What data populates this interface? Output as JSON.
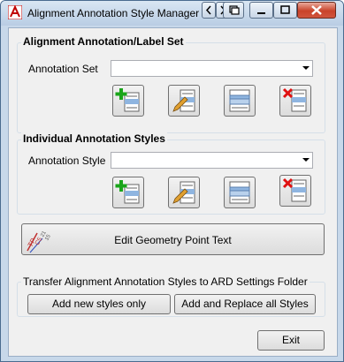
{
  "window": {
    "title": "Alignment Annotation Style Manager"
  },
  "alignment_set": {
    "heading": "Alignment Annotation/Label Set",
    "label": "Annotation Set",
    "value": ""
  },
  "individual_styles": {
    "heading": "Individual Annotation Styles",
    "label": "Annotation Style",
    "value": ""
  },
  "edit_geometry_button": "Edit Geometry Point Text",
  "transfer": {
    "heading": "Transfer Alignment Annotation Styles to ARD Settings Folder",
    "add_new_button": "Add new styles only",
    "add_replace_button": "Add and Replace all Styles"
  },
  "exit_button": "Exit",
  "icons": {
    "app": "autocad-icon",
    "add": "add-style-icon",
    "edit": "edit-style-icon",
    "copy": "copy-style-icon",
    "delete": "delete-style-icon",
    "geometry": "geometry-point-icon"
  },
  "colors": {
    "titlebar": "#c7d8ea",
    "add_green": "#1aa51a",
    "delete_red": "#e01010",
    "pencil": "#e0a030"
  }
}
